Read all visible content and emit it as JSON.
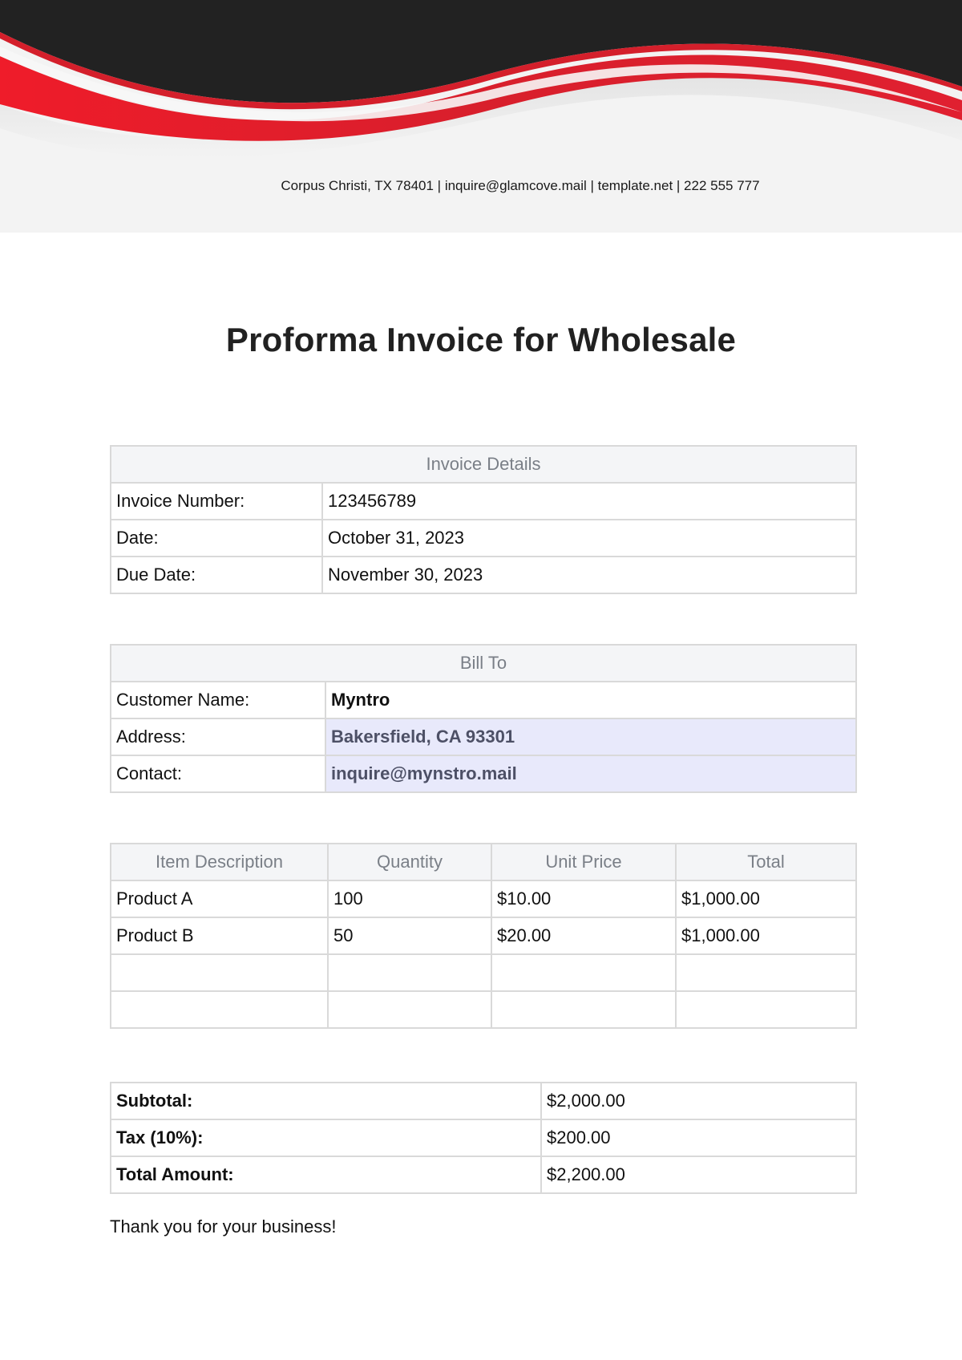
{
  "header": {
    "contact": "Corpus Christi, TX 78401 | inquire@glamcove.mail | template.net | 222 555 777"
  },
  "title": "Proforma Invoice for Wholesale",
  "invoice_details": {
    "heading": "Invoice Details",
    "rows": [
      {
        "label": "Invoice Number:",
        "value": "123456789"
      },
      {
        "label": "Date:",
        "value": "October 31, 2023"
      },
      {
        "label": "Due Date:",
        "value": "November 30, 2023"
      }
    ]
  },
  "bill_to": {
    "heading": "Bill To",
    "rows": [
      {
        "label": "Customer Name:",
        "value": "Myntro"
      },
      {
        "label": "Address:",
        "value": "Bakersfield, CA 93301"
      },
      {
        "label": "Contact:",
        "value": "inquire@mynstro.mail"
      }
    ]
  },
  "items": {
    "columns": [
      "Item Description",
      "Quantity",
      "Unit Price",
      "Total"
    ],
    "rows": [
      [
        "Product A",
        "100",
        "$10.00",
        "$1,000.00"
      ],
      [
        "Product B",
        "50",
        "$20.00",
        "$1,000.00"
      ],
      [
        "",
        "",
        "",
        ""
      ],
      [
        "",
        "",
        "",
        ""
      ]
    ]
  },
  "totals": {
    "rows": [
      {
        "label": "Subtotal:",
        "value": "$2,000.00"
      },
      {
        "label": "Tax (10%):",
        "value": "$200.00"
      },
      {
        "label": "Total Amount:",
        "value": "$2,200.00"
      }
    ]
  },
  "footer": {
    "thanks": "Thank you for your business!"
  },
  "colors": {
    "header_dark": "#222222",
    "accent_red": "#e21b2a",
    "header_bg": "#f3f3f3",
    "table_head_bg": "#f4f5f7",
    "highlight_bg": "#e8e9fb"
  }
}
